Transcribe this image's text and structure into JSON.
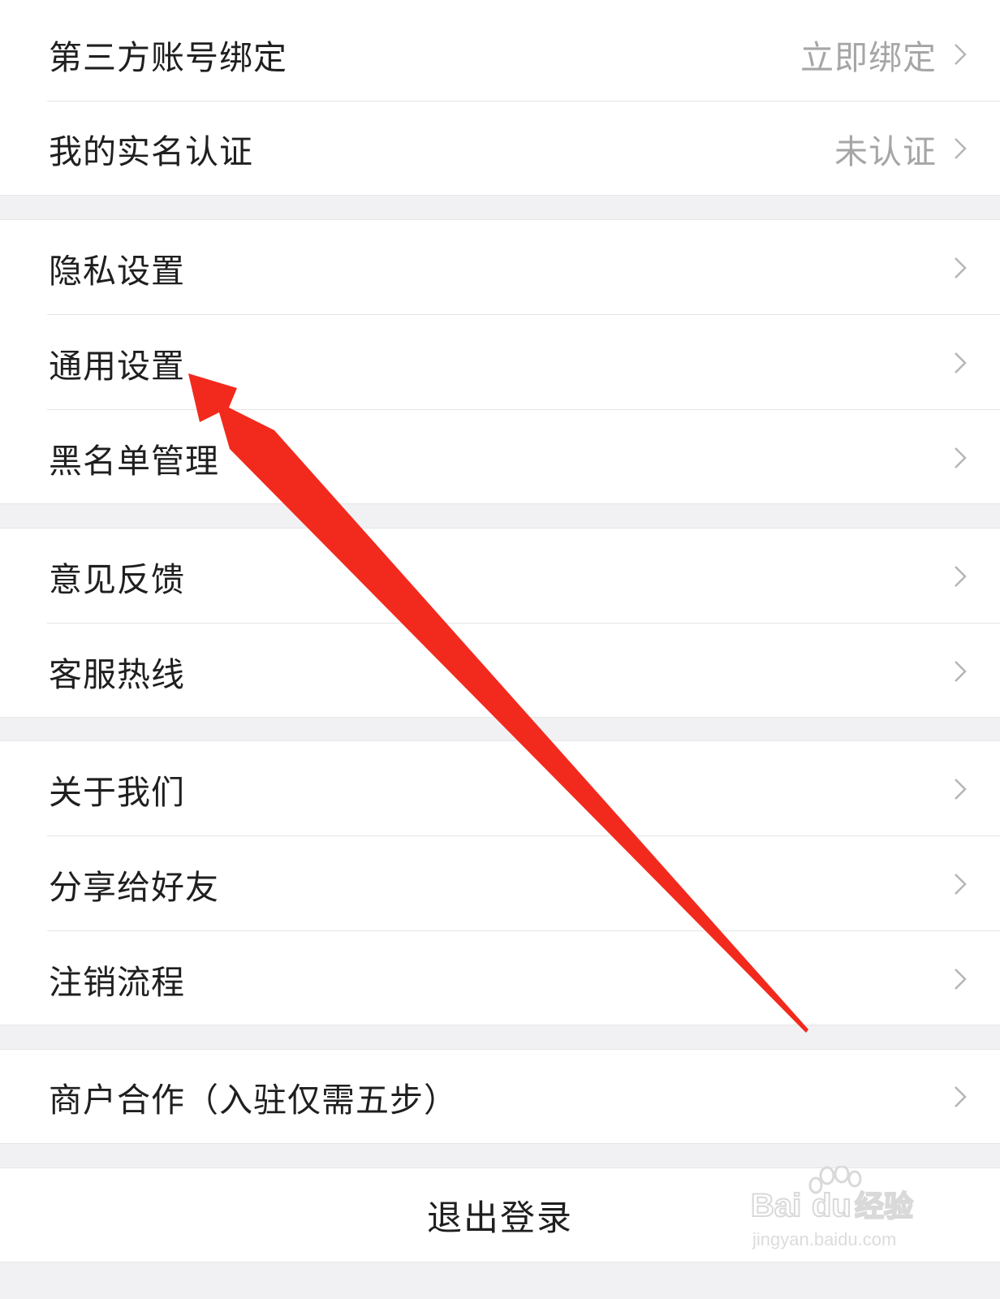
{
  "settings_groups": [
    {
      "items": [
        {
          "label": "第三方账号绑定",
          "value": "立即绑定"
        },
        {
          "label": "我的实名认证",
          "value": "未认证"
        }
      ]
    },
    {
      "items": [
        {
          "label": "隐私设置",
          "value": ""
        },
        {
          "label": "通用设置",
          "value": ""
        },
        {
          "label": "黑名单管理",
          "value": ""
        }
      ]
    },
    {
      "items": [
        {
          "label": "意见反馈",
          "value": ""
        },
        {
          "label": "客服热线",
          "value": ""
        }
      ]
    },
    {
      "items": [
        {
          "label": "关于我们",
          "value": ""
        },
        {
          "label": "分享给好友",
          "value": ""
        },
        {
          "label": "注销流程",
          "value": ""
        }
      ]
    },
    {
      "items": [
        {
          "label": "商户合作（入驻仅需五步）",
          "value": ""
        }
      ]
    }
  ],
  "logout": {
    "label": "退出登录"
  },
  "annotation": {
    "color": "#f22a1e",
    "icon": "red-arrow-pointing-to-general-settings"
  },
  "watermark": {
    "brand": "Baidu经验",
    "url": "jingyan.baidu.com",
    "icon": "paw-icon"
  },
  "colors": {
    "background": "#f1f1f3",
    "row": "#ffffff",
    "label": "#1f1f1f",
    "value": "#a6a6a6",
    "chevron": "#b5b5b5"
  }
}
